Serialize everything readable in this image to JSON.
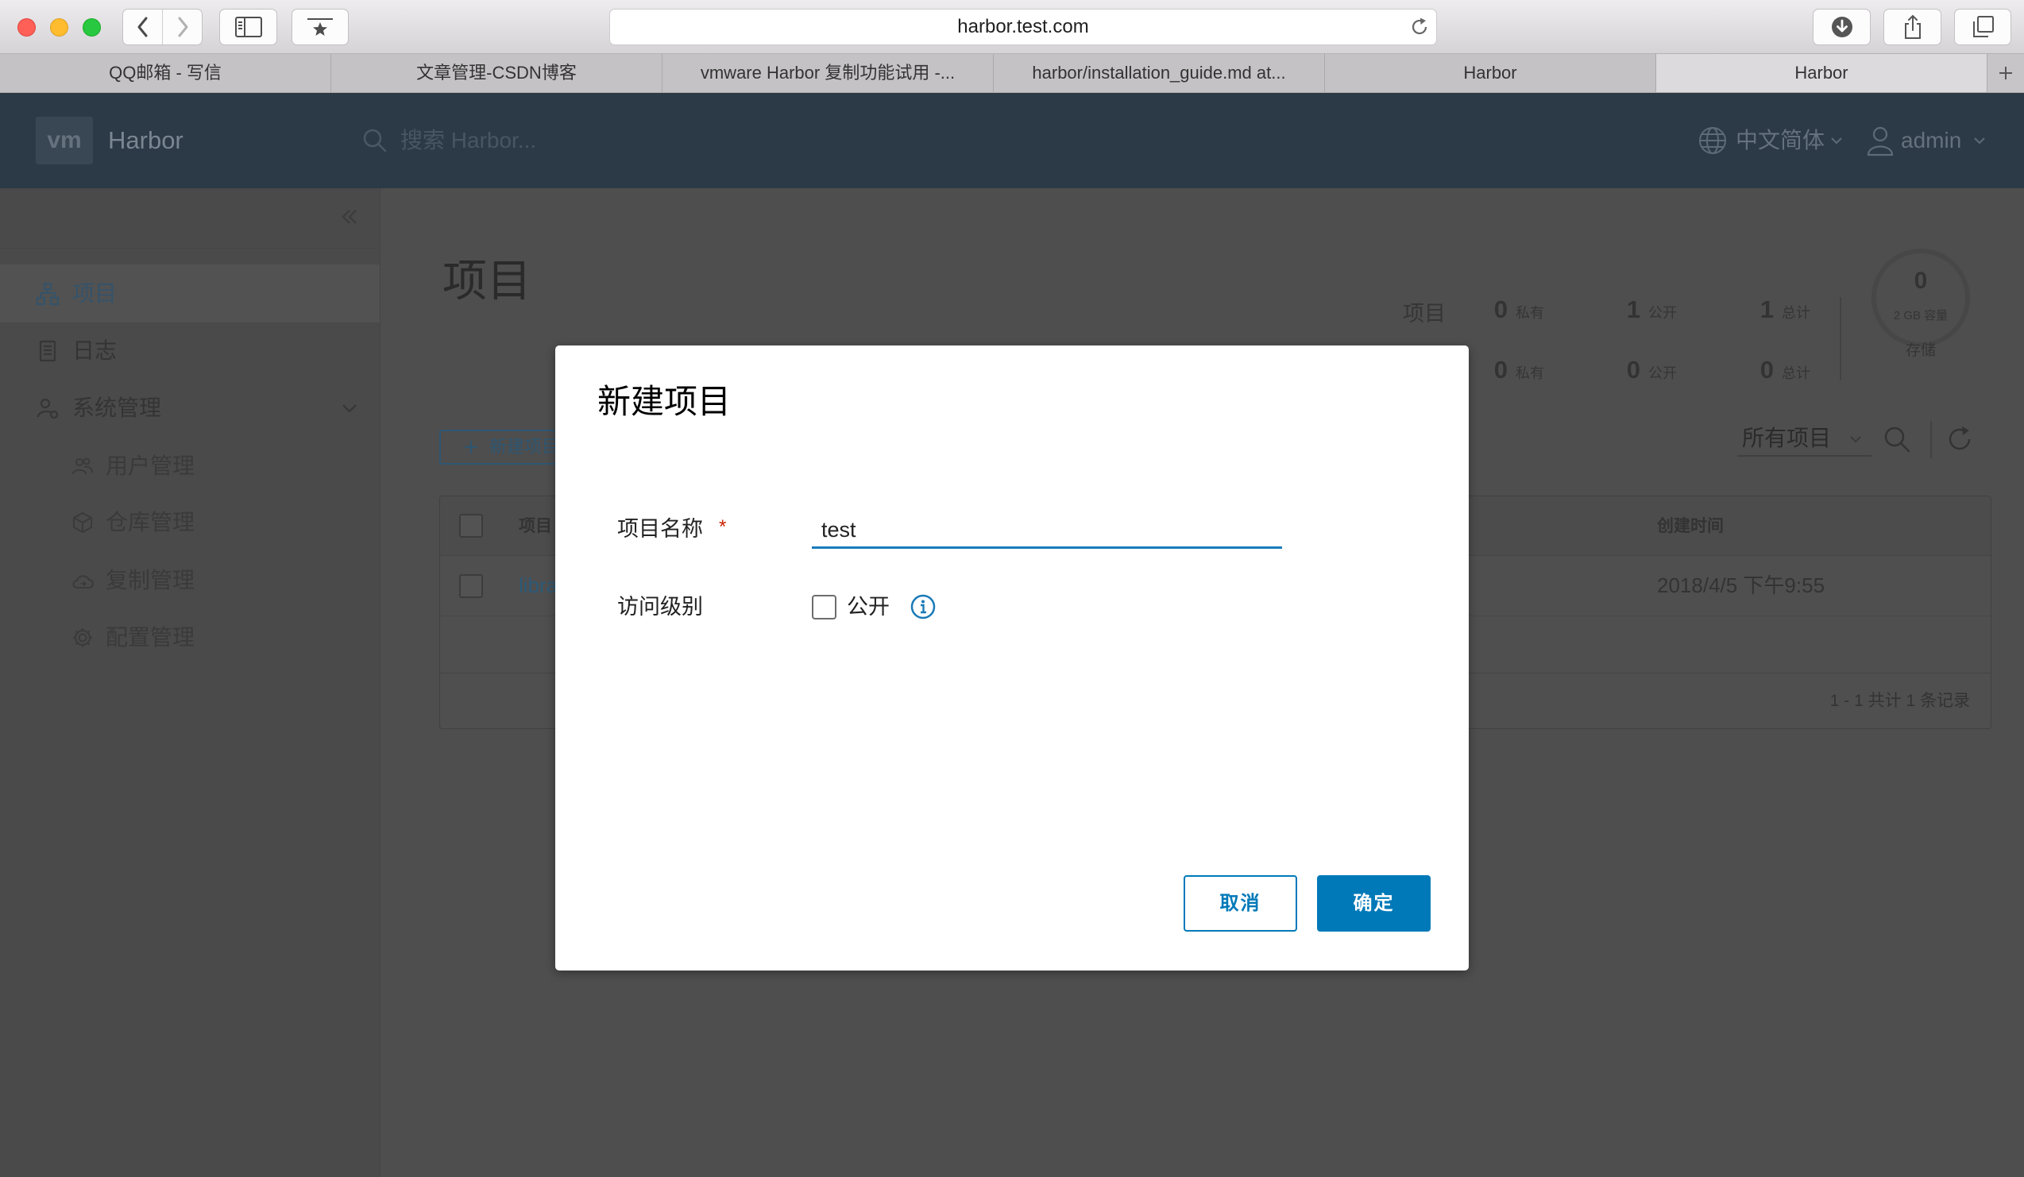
{
  "browser": {
    "url": "harbor.test.com",
    "tabs": [
      {
        "label": "QQ邮箱 - 写信",
        "active": false
      },
      {
        "label": "文章管理-CSDN博客",
        "active": false
      },
      {
        "label": "vmware Harbor 复制功能试用 -...",
        "active": false
      },
      {
        "label": "harbor/installation_guide.md at...",
        "active": false
      },
      {
        "label": "Harbor",
        "active": false
      },
      {
        "label": "Harbor",
        "active": true
      }
    ]
  },
  "header": {
    "logo": "vm",
    "app_name": "Harbor",
    "search_placeholder": "搜索 Harbor...",
    "language": "中文简体",
    "user": "admin"
  },
  "sidebar": {
    "items": [
      {
        "label": "项目",
        "icon": "project-icon",
        "active": true
      },
      {
        "label": "日志",
        "icon": "log-icon",
        "active": false
      },
      {
        "label": "系统管理",
        "icon": "admin-icon",
        "active": false
      }
    ],
    "sub_items": [
      {
        "label": "用户管理",
        "icon": "users-icon"
      },
      {
        "label": "仓库管理",
        "icon": "cube-icon"
      },
      {
        "label": "复制管理",
        "icon": "cloud-icon"
      },
      {
        "label": "配置管理",
        "icon": "gear-icon"
      }
    ]
  },
  "main": {
    "title": "项目",
    "stats": {
      "label": "项目",
      "rows": [
        [
          {
            "value": "0",
            "unit": "私有"
          },
          {
            "value": "1",
            "unit": "公开"
          },
          {
            "value": "1",
            "unit": "总计"
          }
        ],
        [
          {
            "value": "0",
            "unit": "私有"
          },
          {
            "value": "0",
            "unit": "公开"
          },
          {
            "value": "0",
            "unit": "总计"
          }
        ]
      ],
      "storage": {
        "value": "0",
        "capacity": "2 GB 容量",
        "label": "存储"
      }
    },
    "new_project_button": "新建项目",
    "filter": "所有项目",
    "table": {
      "columns": [
        "项目",
        "创建时间"
      ],
      "rows": [
        {
          "name": "libra",
          "created": "2018/4/5 下午9:55"
        }
      ],
      "footer": "1 - 1 共计 1 条记录"
    }
  },
  "modal": {
    "title": "新建项目",
    "name_label": "项目名称",
    "required_mark": "*",
    "name_value": "test",
    "access_label": "访问级别",
    "public_label": "公开",
    "public_checked": false,
    "cancel": "取消",
    "confirm": "确定"
  },
  "colors": {
    "accent": "#0079b8",
    "required": "#c92100",
    "header_dimmed": "#2c3a47"
  }
}
